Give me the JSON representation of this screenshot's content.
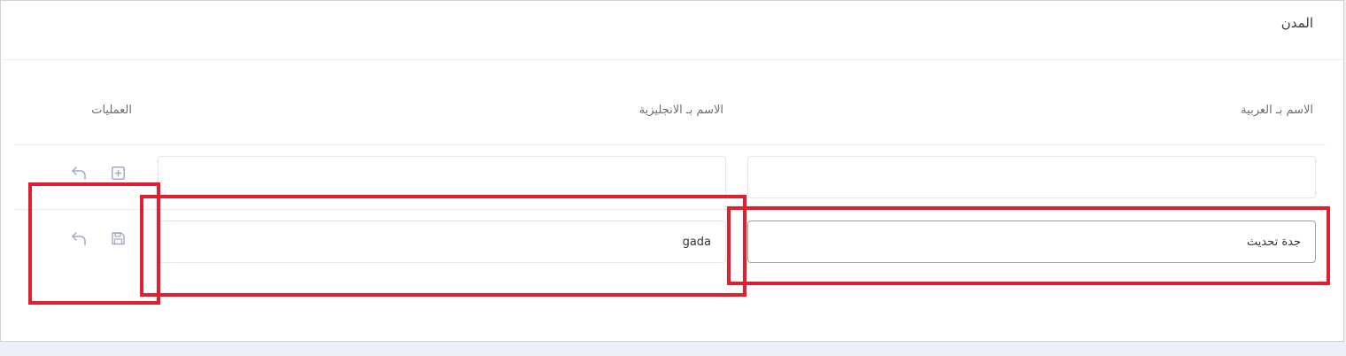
{
  "card": {
    "title": "المدن"
  },
  "columns": {
    "arabic_name": "الاسم بـ العربية",
    "english_name": "الاسم بـ الانجليزية",
    "operations": "العمليات"
  },
  "new_row": {
    "arabic_value": "",
    "english_value": "",
    "actions": {
      "add_icon": "plus-square-icon",
      "undo_icon": "undo-arrow-icon"
    }
  },
  "edit_row": {
    "arabic_value": "جدة تحديث",
    "english_value": "gada",
    "actions": {
      "save_icon": "floppy-disk-icon",
      "undo_icon": "undo-arrow-icon"
    }
  },
  "colors": {
    "highlight": "#e0202f",
    "icon": "#a4a9c4",
    "background": "#eef0f7"
  }
}
